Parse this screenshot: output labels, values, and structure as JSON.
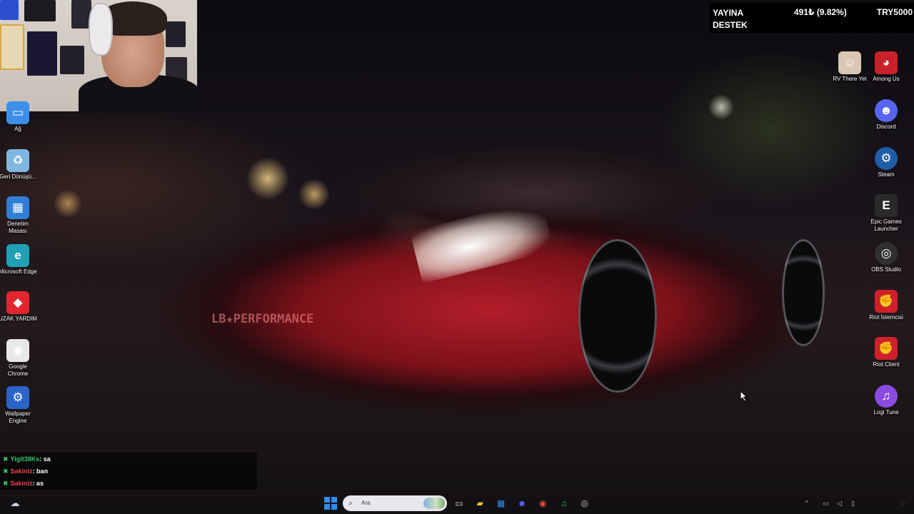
{
  "donation": {
    "label_line1": "YAYINA",
    "label_line2": "DESTEK",
    "amount": "491₺ (9.82%)",
    "goal": "TRY5000",
    "progress_fraction": 0.0982
  },
  "desktop_left": [
    {
      "label": "Ağ",
      "icon": "network-icon",
      "color": "#3c8ee8",
      "glyph": "▭"
    },
    {
      "label": "Geri Dönüşü...",
      "icon": "recycle-bin-icon",
      "color": "#7fb7e0",
      "glyph": "♻"
    },
    {
      "label": "Denetim Masası",
      "icon": "control-panel-icon",
      "color": "#2f7fd6",
      "glyph": "▦"
    },
    {
      "label": "Microsoft Edge",
      "icon": "edge-icon",
      "color": "#1fa0b5",
      "glyph": "e"
    },
    {
      "label": "UZAK YARDIM",
      "icon": "anydesk-icon",
      "color": "#e0262f",
      "glyph": "◆"
    },
    {
      "label": "Google Chrome",
      "icon": "chrome-icon",
      "color": "#e8e8e8",
      "glyph": "◉"
    },
    {
      "label": "Wallpaper Engine",
      "icon": "wallpaper-engine-icon",
      "color": "#2a64c9",
      "glyph": "⚙"
    }
  ],
  "desktop_right": [
    {
      "label": "RV There Yet",
      "icon": "rv-there-yet-icon",
      "color": "#d9c7b3",
      "glyph": "☺"
    },
    {
      "label": "Among Us",
      "icon": "among-us-icon",
      "color": "#c9212a",
      "glyph": "◕"
    },
    {
      "label": "Discord",
      "icon": "discord-icon",
      "color": "#5865f2",
      "glyph": "☻"
    },
    {
      "label": "Steam",
      "icon": "steam-icon",
      "color": "#1f5ea8",
      "glyph": "⚙"
    },
    {
      "label": "Epic Games Launcher",
      "icon": "epic-games-icon",
      "color": "#2a2a2a",
      "glyph": "E"
    },
    {
      "label": "OBS Studio",
      "icon": "obs-studio-icon",
      "color": "#303030",
      "glyph": "◎"
    },
    {
      "label": "Riot İstemcisi",
      "icon": "riot-client-icon",
      "color": "#d0202a",
      "glyph": "✊"
    },
    {
      "label": "Riot Client",
      "icon": "riot-client-icon",
      "color": "#d0202a",
      "glyph": "✊"
    },
    {
      "label": "Logi Tune",
      "icon": "logi-tune-icon",
      "color": "#8a4be0",
      "glyph": "♫"
    }
  ],
  "wallpaper": {
    "car_lettering": "LB★PERFORMANCE"
  },
  "chat": {
    "messages": [
      {
        "user": "Yigit38Ks",
        "text": ": sa"
      },
      {
        "user": "Sakiniz",
        "text": ": ban"
      },
      {
        "user": "Sakiniz",
        "text": ": as"
      }
    ]
  },
  "taskbar": {
    "search_placeholder": "Ara",
    "apps": [
      {
        "icon": "task-view-icon",
        "glyph": "▭",
        "color": "#dcdcdc"
      },
      {
        "icon": "file-explorer-icon",
        "glyph": "▰",
        "color": "#f2c230"
      },
      {
        "icon": "microsoft-store-icon",
        "glyph": "▦",
        "color": "#2a8de8"
      },
      {
        "icon": "discord-icon",
        "glyph": "☻",
        "color": "#5865f2"
      },
      {
        "icon": "chrome-icon",
        "glyph": "◉",
        "color": "#e84a3c"
      },
      {
        "icon": "spotify-icon",
        "glyph": "♫",
        "color": "#1db954"
      },
      {
        "icon": "obs-studio-icon",
        "glyph": "◎",
        "color": "#cfcfcf"
      }
    ]
  },
  "colors": {
    "chat_user_green": "#32c56a",
    "chat_user_red": "#e8414d",
    "donation_bg": "#000000"
  }
}
